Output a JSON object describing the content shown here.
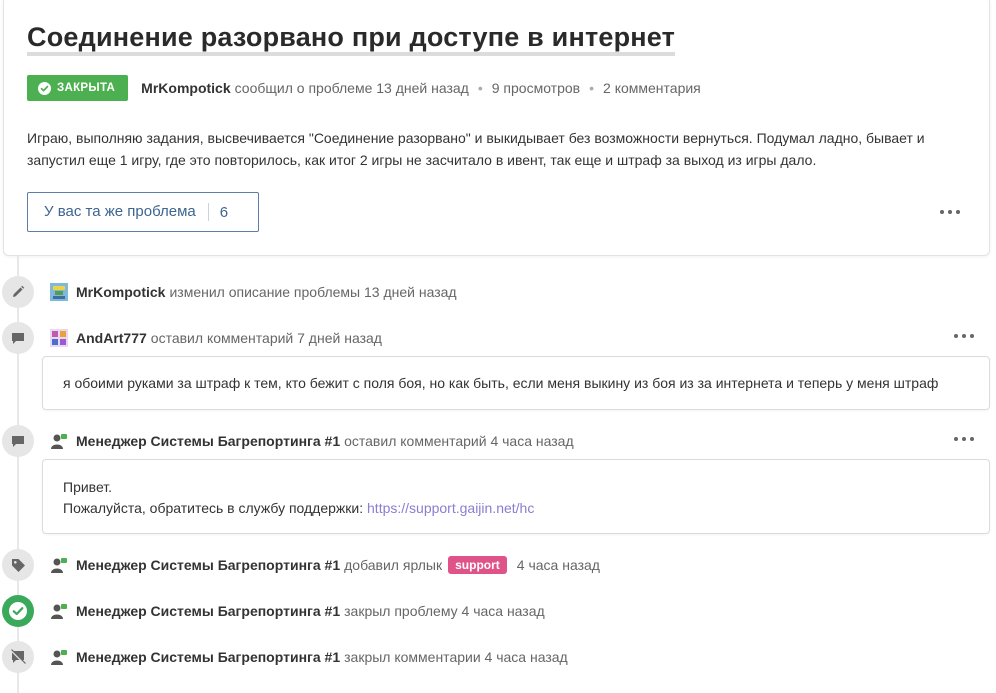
{
  "issue": {
    "title": "Соединение разорвано при доступе в интернет",
    "status_badge": "ЗАКРЫТА",
    "author": "MrKompotick",
    "reported_text": "сообщил о проблеме 13 дней назад",
    "views": "9 просмотров",
    "comments_count": "2 комментария",
    "description": "Играю, выполняю задания, высвечивается \"Соединение разорвано\" и выкидывает без возможности вернуться. Подумал ладно, бывает и запустил еще 1 игру, где это повторилось, как итог 2 игры не засчитало в ивент, так еще и штраф за выход из игры дало.",
    "same_problem_label": "У вас та же проблема",
    "same_problem_count": "6",
    "colors": {
      "closed_badge": "#4caf50",
      "button_border": "#5b7fa6",
      "label_support": "#e05389",
      "link": "#8a7ecf"
    }
  },
  "timeline": [
    {
      "icon": "pencil-icon",
      "user": "MrKompotick",
      "text": "изменил описание проблемы 13 дней назад"
    },
    {
      "icon": "comment-icon",
      "user": "AndArt777",
      "text": "оставил комментарий 7 дней назад",
      "comment": "я обоими руками за штраф к тем, кто бежит с поля боя, но как быть, если меня выкину из боя из за интернета и теперь у меня штраф"
    },
    {
      "icon": "comment-icon",
      "user": "Менеджер Системы Багрепортинга #1",
      "text": "оставил комментарий 4 часа назад",
      "comment_line1": "Привет.",
      "comment_line2_prefix": "Пожалуйста, обратитесь в службу поддержки: ",
      "comment_link": "https://support.gaijin.net/hc"
    },
    {
      "icon": "tag-icon",
      "user": "Менеджер Системы Багрепортинга #1",
      "text_before": "добавил ярлык",
      "label": "support",
      "text_after": "4 часа назад"
    },
    {
      "icon": "check-circle-icon",
      "user": "Менеджер Системы Багрепортинга #1",
      "text": "закрыл проблему 4 часа назад"
    },
    {
      "icon": "comments-off-icon",
      "user": "Менеджер Системы Багрепортинга #1",
      "text": "закрыл комментарии 4 часа назад"
    }
  ]
}
